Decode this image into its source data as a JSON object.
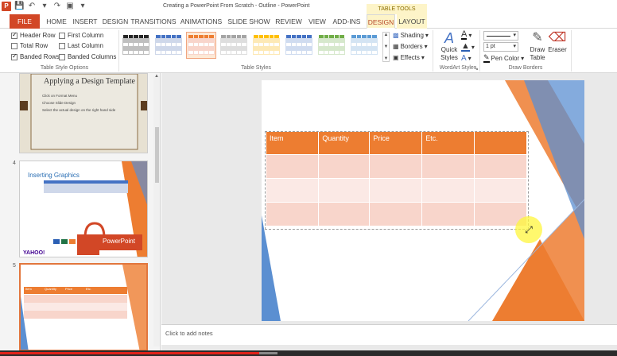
{
  "window": {
    "title": "Creating a PowerPoint From Scratch - Outline - PowerPoint",
    "table_tools": "TABLE TOOLS"
  },
  "tabs": [
    {
      "label": "FILE"
    },
    {
      "label": "HOME"
    },
    {
      "label": "INSERT"
    },
    {
      "label": "DESIGN"
    },
    {
      "label": "TRANSITIONS"
    },
    {
      "label": "ANIMATIONS"
    },
    {
      "label": "SLIDE SHOW"
    },
    {
      "label": "REVIEW"
    },
    {
      "label": "VIEW"
    },
    {
      "label": "ADD-INS"
    },
    {
      "label": "DESIGN"
    },
    {
      "label": "LAYOUT"
    }
  ],
  "options": {
    "header_row": "Header Row",
    "total_row": "Total Row",
    "banded_rows": "Banded Rows",
    "first_column": "First Column",
    "last_column": "Last Column",
    "banded_columns": "Banded Columns",
    "group_label": "Table Style Options"
  },
  "table_styles": {
    "group_label": "Table Styles",
    "swatches": [
      {
        "header": "#262626",
        "band": "#bfbfbf"
      },
      {
        "header": "#4472c4",
        "band": "#cfd8ea"
      },
      {
        "header": "#ed7d31",
        "band": "#f8d5cb"
      },
      {
        "header": "#a5a5a5",
        "band": "#dedede"
      },
      {
        "header": "#ffc000",
        "band": "#fde9b6"
      },
      {
        "header": "#4472c4",
        "band": "#d0dcf0"
      },
      {
        "header": "#70ad47",
        "band": "#d6e8cc"
      },
      {
        "header": "#5b9bd5",
        "band": "#d4e4f3"
      }
    ]
  },
  "shading": {
    "shading": "Shading",
    "borders": "Borders",
    "effects": "Effects"
  },
  "wordart": {
    "quick_styles_1": "Quick",
    "quick_styles_2": "Styles",
    "group_label": "WordArt Styles"
  },
  "draw_borders": {
    "pen_weight": "1 pt",
    "pen_color": "Pen Color",
    "draw_table_1": "Draw",
    "draw_table_2": "Table",
    "eraser": "Eraser",
    "group_label": "Draw Borders"
  },
  "slides": {
    "slide3_title": "Applying a Design Template",
    "slide3_bullets": [
      "Click on Format Menu",
      "Choose Slide Design",
      "Select the actual design on the right hand side"
    ],
    "slide4_num": "4",
    "slide4_title": "Inserting Graphics",
    "slide4_brand": "PowerPoint",
    "slide4_logo": "YAHOO!",
    "slide5_num": "5",
    "slide5_headers": [
      "Item",
      "Quantity",
      "Price",
      "Etc."
    ]
  },
  "table": {
    "headers": [
      "Item",
      "Quantity",
      "Price",
      "Etc.",
      ""
    ],
    "rows": [
      [
        "",
        "",
        "",
        "",
        ""
      ],
      [
        "",
        "",
        "",
        "",
        ""
      ],
      [
        "",
        "",
        "",
        "",
        ""
      ]
    ]
  },
  "notes": {
    "placeholder": "Click to add notes"
  },
  "video_progress": {
    "played": 0.42,
    "loaded": 0.45
  },
  "colors": {
    "accent": "#d24726",
    "orange": "#ed7d31",
    "blue": "#5b8fd1"
  }
}
